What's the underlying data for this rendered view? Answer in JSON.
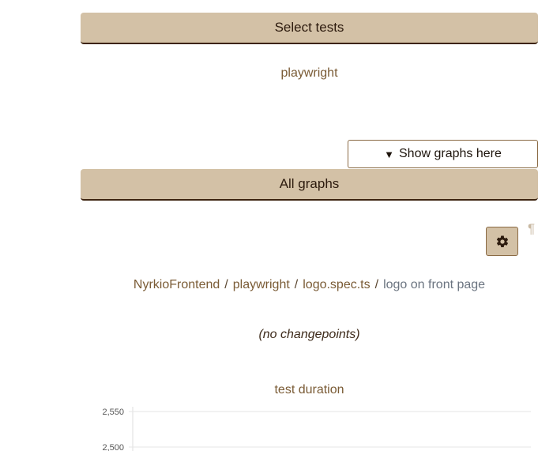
{
  "select_tests": {
    "label": "Select tests"
  },
  "tests": {
    "item_label": "playwright"
  },
  "show_graphs": {
    "label": "Show graphs here"
  },
  "all_graphs": {
    "label": "All graphs"
  },
  "settings": {
    "icon": "gear-icon",
    "pilcrow": "¶"
  },
  "breadcrumb": {
    "items": [
      "NyrkioFrontend",
      "playwright",
      "logo.spec.ts"
    ],
    "current": "logo on front page",
    "separator": "/"
  },
  "changepoints": {
    "text": "(no changepoints)"
  },
  "chart_data": {
    "type": "line",
    "title": "test duration",
    "y_ticks": [
      2550,
      2500
    ],
    "y_tick_labels": [
      "2,550",
      "2,500"
    ],
    "ylim": [
      2500,
      2550
    ],
    "series": [],
    "grid": true
  }
}
